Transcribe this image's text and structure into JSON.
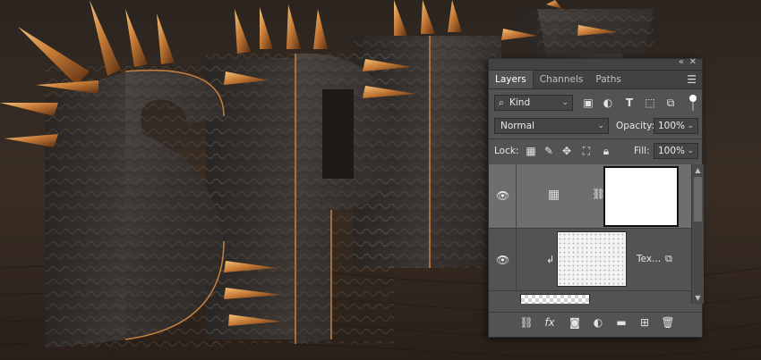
{
  "panel": {
    "tabs": [
      "Layers",
      "Channels",
      "Paths"
    ],
    "filter": {
      "kind_label": "Kind"
    },
    "blend_mode": "Normal",
    "opacity": {
      "label": "Opacity:",
      "value": "100%"
    },
    "lock": {
      "label": "Lock:"
    },
    "fill": {
      "label": "Fill:",
      "value": "100%"
    },
    "layers": [
      {
        "type": "adjustment",
        "visible": true,
        "selected": true
      },
      {
        "type": "texture",
        "name": "Tex...",
        "visible": true,
        "clipped": true
      },
      {
        "type": "partial",
        "visible": false
      }
    ],
    "icons": {
      "collapse": "«",
      "close": "✕",
      "menu": "☰",
      "filter_text": "T",
      "fx": "fx"
    }
  },
  "colors": {
    "panel_bg": "#535353",
    "selected_layer": "#6e6e6e",
    "copper": "#c8803e",
    "metal_dark": "#3a3532"
  }
}
